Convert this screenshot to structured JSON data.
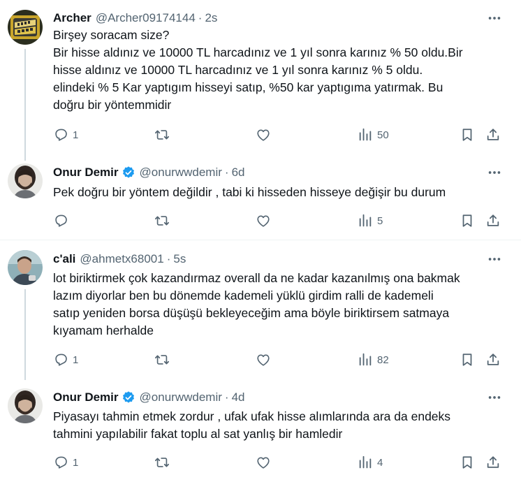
{
  "colors": {
    "text": "#0f1419",
    "muted": "#536471",
    "verified": "#1d9bf0",
    "divider": "#eff3f4",
    "thread_line": "#cfd9de"
  },
  "tweets": [
    {
      "name": "Archer",
      "handle": "@Archer09174144",
      "dot": "·",
      "time": "2s",
      "verified": false,
      "avatar": "avatar-archer",
      "lines": [
        "Birşey soracam size?",
        "Bir hisse aldınız ve 10000 TL harcadınız ve 1 yıl sonra karınız % 50 oldu.Bir",
        "hisse aldınız ve 10000 TL harcadınız ve 1 yıl sonra karınız % 5 oldu.",
        "elindeki % 5 Kar yaptıgım hisseyi satıp, %50 kar yaptıgıma yatırmak. Bu",
        "doğru bir yöntemmidir"
      ],
      "replies": "1",
      "views": "50"
    },
    {
      "name": "Onur Demir",
      "handle": "@onurwwdemir",
      "dot": "·",
      "time": "6d",
      "verified": true,
      "avatar": "avatar-onur",
      "lines": [
        "Pek doğru bir yöntem değildir , tabi ki hisseden hisseye değişir bu durum"
      ],
      "replies": "",
      "views": "5"
    },
    {
      "name": "c'ali",
      "handle": "@ahmetx68001",
      "dot": "·",
      "time": "5s",
      "verified": false,
      "avatar": "avatar-cali",
      "lines": [
        "lot biriktirmek çok kazandırmaz overall da ne kadar kazanılmış ona bakmak",
        "lazım diyorlar ben bu dönemde kademeli yüklü girdim ralli de kademeli",
        "satıp yeniden borsa düşüşü bekleyeceğim ama böyle biriktirsem satmaya",
        "kıyamam herhalde"
      ],
      "replies": "1",
      "views": "82"
    },
    {
      "name": "Onur Demir",
      "handle": "@onurwwdemir",
      "dot": "·",
      "time": "4d",
      "verified": true,
      "avatar": "avatar-onur",
      "lines": [
        "Piyasayı tahmin etmek zordur , ufak ufak hisse alımlarında ara da endeks",
        "tahmini yapılabilir fakat toplu al sat yanlış bir hamledir"
      ],
      "replies": "1",
      "views": "4"
    }
  ]
}
